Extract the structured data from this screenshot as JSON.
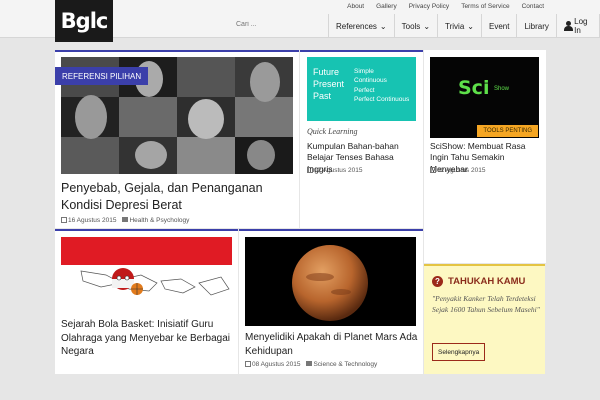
{
  "logo": {
    "text": "Bglc"
  },
  "toplinks": [
    "About",
    "Gallery",
    "Privacy Policy",
    "Terms of Service",
    "Contact"
  ],
  "search": {
    "placeholder": "Cari ..."
  },
  "nav": [
    {
      "label": "References",
      "dropdown": true
    },
    {
      "label": "Tools",
      "dropdown": true
    },
    {
      "label": "Trivia",
      "dropdown": true
    },
    {
      "label": "Event",
      "dropdown": false
    },
    {
      "label": "Library",
      "dropdown": false
    },
    {
      "label": "Log In",
      "icon": "user-icon"
    }
  ],
  "featured": {
    "badge": "REFERENSI PILIHAN",
    "title": "Penyebab, Gejala, dan Penanganan Kondisi Depresi Berat",
    "date": "16 Agustus 2015",
    "category": "Health & Psychology"
  },
  "card_tenses": {
    "image_lines_left": [
      "Future",
      "Present",
      "Past"
    ],
    "image_lines_right": [
      "Simple",
      "Continuous",
      "Perfect",
      "Perfect Continuous"
    ],
    "kicker": "Quick Learning",
    "title": "Kumpulan Bahan-bahan Belajar Tenses Bahasa Inggris",
    "date": "12 Agustus 2015"
  },
  "card_scishow": {
    "image_text": "Sci",
    "image_subtext": "Show",
    "badge": "TOOLS PENTING",
    "title": "SciShow: Membuat Rasa Ingin Tahu Semakin Menyebar",
    "date": "02 Agustus 2015"
  },
  "card_basket": {
    "title": "Sejarah Bola Basket: Inisiatif Guru Olahraga yang Menyebar ke Berbagai Negara"
  },
  "card_mars": {
    "title": "Menyelidiki Apakah di Planet Mars Ada Kehidupan",
    "date": "08 Agustus 2015",
    "category": "Science & Technology"
  },
  "tahukah": {
    "heading": "TAHUKAH KAMU",
    "quote": "\"Penyakit Kanker Telah Terdeteksi Sejak 1600 Tahun Sebelum Masehi\"",
    "button": "Selengkapnya"
  },
  "colors": {
    "accent": "#3b3faa",
    "orange": "#f5a623",
    "teal": "#17c3b2",
    "yellow_box": "#fdf8c2"
  }
}
